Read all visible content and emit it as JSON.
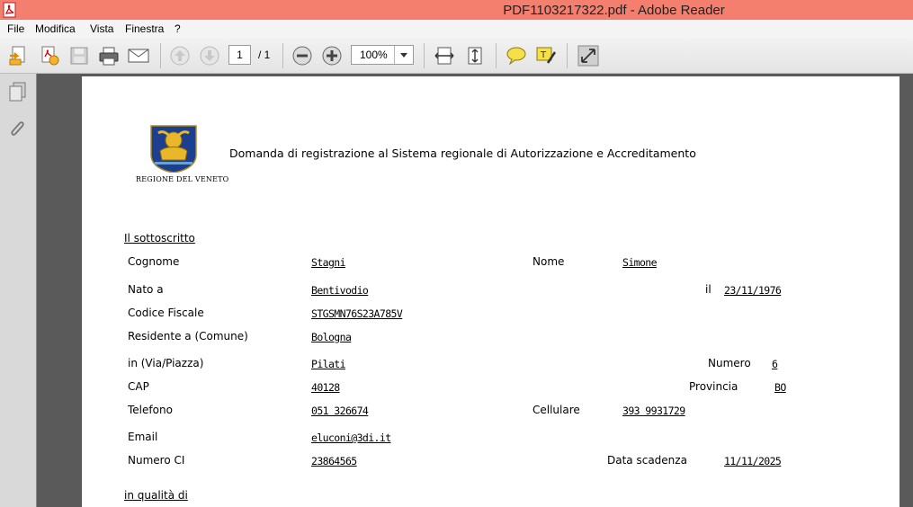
{
  "window": {
    "title": "PDF1103217322.pdf - Adobe Reader"
  },
  "menu": {
    "file": "File",
    "modifica": "Modifica",
    "vista": "Vista",
    "finestra": "Finestra",
    "help": "?"
  },
  "toolbar": {
    "page_current": "1",
    "page_total": "/ 1",
    "zoom": "100%"
  },
  "document": {
    "title": "Domanda di registrazione al Sistema regionale di Autorizzazione e Accreditamento",
    "logo_caption": "REGIONE DEL VENETO",
    "section1": "Il sottoscritto",
    "section2": "in qualità di",
    "fields": {
      "cognome_label": "Cognome",
      "cognome": "Stagni",
      "nome_label": "Nome",
      "nome": "Simone",
      "nato_label": "Nato a",
      "nato": "Bentivodio",
      "il_label": "il",
      "il": "23/11/1976",
      "cf_label": "Codice Fiscale",
      "cf": "STGSMN76S23A785V",
      "residente_label": "Residente a (Comune)",
      "residente": "Bologna",
      "via_label": "in (Via/Piazza)",
      "via": "Pilati",
      "numero_label": "Numero",
      "numero": "6",
      "cap_label": "CAP",
      "cap": "40128",
      "provincia_label": "Provincia",
      "provincia": "BO",
      "telefono_label": "Telefono",
      "telefono": "051 326674",
      "cellulare_label": "Cellulare",
      "cellulare": "393 9931729",
      "email_label": "Email",
      "email": "eluconi@3di.it",
      "ci_label": "Numero CI",
      "ci": "23864565",
      "scadenza_label": "Data scadenza",
      "scadenza": "11/11/2025"
    }
  },
  "colors": {
    "titlebar": "#f47f6e",
    "background": "#5a5a5a"
  }
}
